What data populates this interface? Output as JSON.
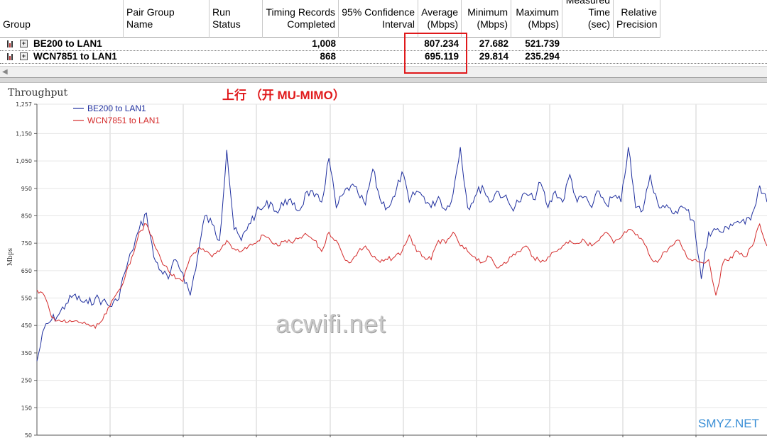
{
  "grid": {
    "headers": [
      {
        "line1": "",
        "line2": "Group"
      },
      {
        "line1": "Pair Group",
        "line2": "Name"
      },
      {
        "line1": "",
        "line2": "Run Status"
      },
      {
        "line1": "Timing Records",
        "line2": "Completed"
      },
      {
        "line1": "95% Confidence",
        "line2": "Interval"
      },
      {
        "line1": "Average",
        "line2": "(Mbps)"
      },
      {
        "line1": "Minimum",
        "line2": "(Mbps)"
      },
      {
        "line1": "Maximum",
        "line2": "(Mbps)"
      },
      {
        "line1": "Measured",
        "line2": "Time (sec)"
      },
      {
        "line1": "Relative",
        "line2": "Precision"
      }
    ],
    "rows": [
      {
        "group": "BE200 to LAN1",
        "records": "1,008",
        "average": "807.234",
        "minimum": "27.682",
        "maximum": "521.739"
      },
      {
        "group": "WCN7851 to LAN1",
        "records": "868",
        "average": "695.119",
        "minimum": "29.814",
        "maximum": "235.294"
      }
    ]
  },
  "annotation": "上行 （开 MU-MIMO）",
  "watermark": "acwifi.net",
  "brand": "SMYZ.NET",
  "chart_data": {
    "type": "line",
    "title": "Throughput",
    "ylabel": "Mbps",
    "xlabel": "",
    "ylim": [
      50,
      1257
    ],
    "yticks": [
      50,
      150,
      250,
      350,
      450,
      550,
      650,
      750,
      850,
      950,
      1050,
      1150,
      1257
    ],
    "ytick_labels": [
      "50",
      "150",
      "250",
      "350",
      "450",
      "550",
      "650",
      "750",
      "850",
      "950",
      "1,050",
      "1,150",
      "1,257"
    ],
    "grid": true,
    "legend_position": "top-left",
    "series": [
      {
        "name": "BE200 to LAN1",
        "color": "#1f2f9e",
        "x": [
          0,
          1,
          2,
          3,
          4,
          5,
          6,
          7,
          8,
          9,
          10,
          11,
          12,
          13,
          14,
          15,
          16,
          17,
          18,
          19,
          20,
          21,
          22,
          23,
          24,
          25,
          26,
          27,
          28,
          29,
          30,
          31,
          32,
          33,
          34,
          35,
          36,
          37,
          38,
          39,
          40,
          41,
          42,
          43,
          44,
          45,
          46,
          47,
          48,
          49,
          50,
          51,
          52,
          53,
          54,
          55,
          56,
          57,
          58,
          59,
          60,
          61,
          62,
          63,
          64,
          65,
          66,
          67,
          68,
          69,
          70,
          71,
          72,
          73,
          74,
          75,
          76,
          77,
          78,
          79,
          80,
          81,
          82,
          83,
          84,
          85,
          86,
          87,
          88,
          89,
          90,
          91,
          92,
          93,
          94,
          95,
          96,
          97,
          98,
          99,
          100
        ],
        "y": [
          320,
          440,
          470,
          490,
          530,
          560,
          540,
          530,
          550,
          540,
          520,
          540,
          640,
          720,
          800,
          860,
          700,
          650,
          620,
          690,
          640,
          560,
          700,
          850,
          820,
          760,
          1090,
          800,
          760,
          820,
          860,
          880,
          900,
          860,
          910,
          890,
          870,
          940,
          920,
          900,
          1060,
          880,
          930,
          960,
          930,
          890,
          1020,
          910,
          880,
          920,
          1010,
          900,
          940,
          920,
          880,
          920,
          870,
          930,
          1100,
          880,
          920,
          960,
          900,
          940,
          920,
          880,
          900,
          930,
          910,
          970,
          880,
          940,
          900,
          1000,
          900,
          920,
          880,
          940,
          890,
          920,
          900,
          1100,
          880,
          870,
          1000,
          900,
          880,
          860,
          880,
          870,
          830,
          620,
          790,
          800,
          790,
          820,
          830,
          820,
          860,
          960,
          900
        ]
      },
      {
        "name": "WCN7851 to LAN1",
        "color": "#d42b2b",
        "x": [
          0,
          1,
          2,
          3,
          4,
          5,
          6,
          7,
          8,
          9,
          10,
          11,
          12,
          13,
          14,
          15,
          16,
          17,
          18,
          19,
          20,
          21,
          22,
          23,
          24,
          25,
          26,
          27,
          28,
          29,
          30,
          31,
          32,
          33,
          34,
          35,
          36,
          37,
          38,
          39,
          40,
          41,
          42,
          43,
          44,
          45,
          46,
          47,
          48,
          49,
          50,
          51,
          52,
          53,
          54,
          55,
          56,
          57,
          58,
          59,
          60,
          61,
          62,
          63,
          64,
          65,
          66,
          67,
          68,
          69,
          70,
          71,
          72,
          73,
          74,
          75,
          76,
          77,
          78,
          79,
          80,
          81,
          82,
          83,
          84,
          85,
          86,
          87,
          88,
          89,
          90,
          91,
          92,
          93,
          94,
          95,
          96,
          97,
          98,
          99,
          100
        ],
        "y": [
          580,
          560,
          480,
          470,
          460,
          465,
          460,
          455,
          440,
          470,
          520,
          570,
          620,
          700,
          790,
          820,
          750,
          690,
          650,
          620,
          610,
          700,
          730,
          720,
          700,
          720,
          760,
          730,
          720,
          740,
          750,
          780,
          760,
          740,
          760,
          750,
          770,
          780,
          760,
          720,
          790,
          760,
          700,
          680,
          720,
          740,
          700,
          680,
          690,
          700,
          720,
          780,
          720,
          700,
          690,
          760,
          750,
          790,
          740,
          720,
          700,
          680,
          700,
          660,
          680,
          700,
          720,
          740,
          700,
          680,
          700,
          720,
          740,
          760,
          750,
          760,
          740,
          760,
          790,
          750,
          770,
          800,
          780,
          760,
          700,
          680,
          720,
          740,
          760,
          700,
          690,
          680,
          690,
          560,
          680,
          700,
          720,
          700,
          740,
          820,
          740
        ]
      }
    ]
  }
}
